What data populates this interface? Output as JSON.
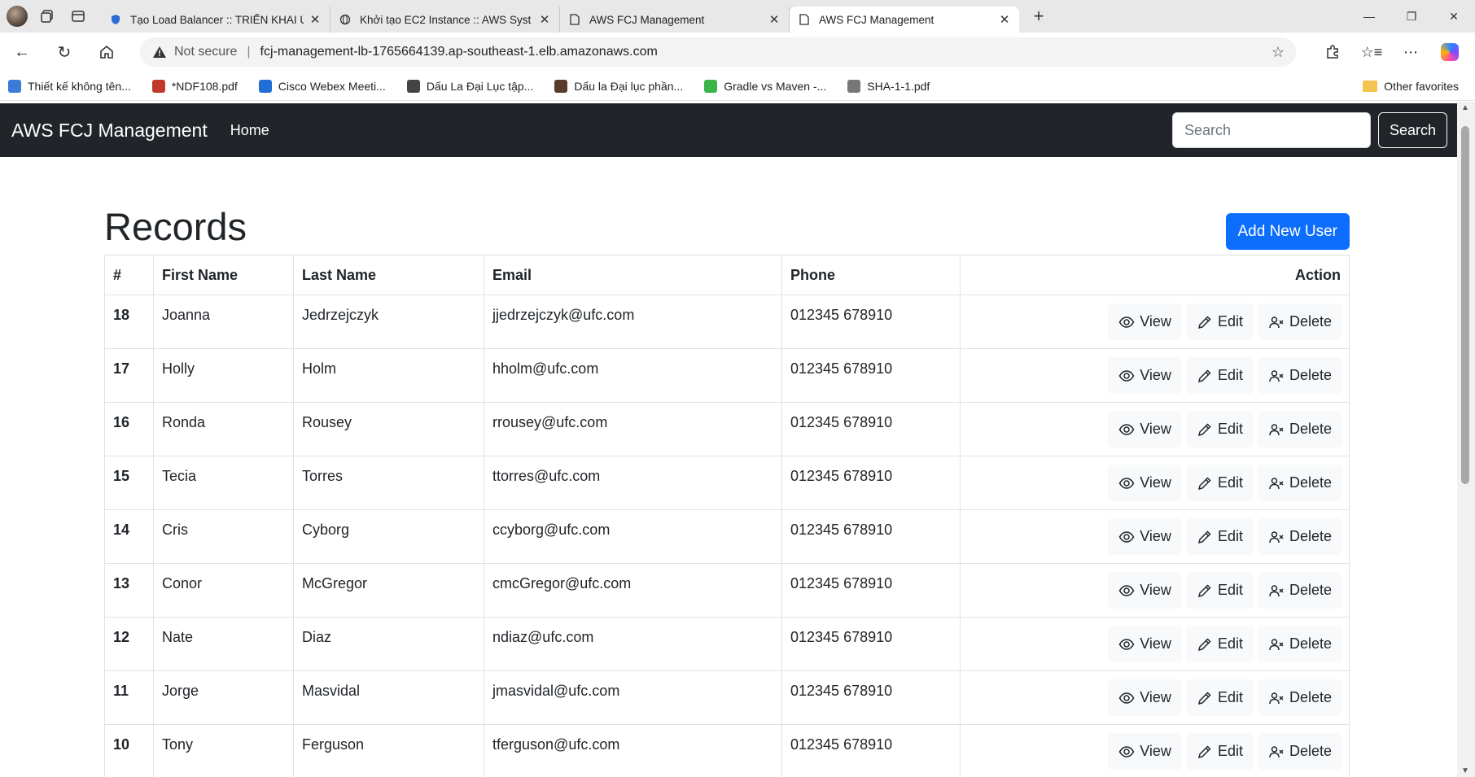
{
  "browser": {
    "tabs": [
      {
        "title": "Tạo Load Balancer :: TRIỂN KHAI Ứ",
        "icon": "shield-icon",
        "active": false
      },
      {
        "title": "Khởi tạo EC2 Instance :: AWS Syst",
        "icon": "globe-icon",
        "active": false
      },
      {
        "title": "AWS FCJ Management",
        "icon": "page-icon",
        "active": false
      },
      {
        "title": "AWS FCJ Management",
        "icon": "page-icon",
        "active": true
      }
    ],
    "address": {
      "security_label": "Not secure",
      "url": "fcj-management-lb-1765664139.ap-southeast-1.elb.amazonaws.com"
    },
    "favorites": [
      {
        "label": "Thiết kế không tên...",
        "color": "#3a7bd5"
      },
      {
        "label": "*NDF108.pdf",
        "color": "#c0392b"
      },
      {
        "label": "Cisco Webex Meeti...",
        "color": "#1f6fd6"
      },
      {
        "label": "Dấu La Đại Lục tập...",
        "color": "#444444"
      },
      {
        "label": "Dấu la Đại lục phần...",
        "color": "#5a3a2a"
      },
      {
        "label": "Gradle vs Maven -...",
        "color": "#3bb54a"
      },
      {
        "label": "SHA-1-1.pdf",
        "color": "#777777"
      }
    ],
    "other_favorites": "Other favorites"
  },
  "app": {
    "brand": "AWS FCJ Management",
    "nav_home": "Home",
    "search_placeholder": "Search",
    "search_button": "Search",
    "page_title": "Records",
    "add_button": "Add New User"
  },
  "table": {
    "headers": {
      "num": "#",
      "first": "First Name",
      "last": "Last Name",
      "email": "Email",
      "phone": "Phone",
      "action": "Action"
    },
    "actions": {
      "view": "View",
      "edit": "Edit",
      "delete": "Delete"
    },
    "rows": [
      {
        "id": "18",
        "first": "Joanna",
        "last": "Jedrzejczyk",
        "email": "jjedrzejczyk@ufc.com",
        "phone": "012345 678910"
      },
      {
        "id": "17",
        "first": "Holly",
        "last": "Holm",
        "email": "hholm@ufc.com",
        "phone": "012345 678910"
      },
      {
        "id": "16",
        "first": "Ronda",
        "last": "Rousey",
        "email": "rrousey@ufc.com",
        "phone": "012345 678910"
      },
      {
        "id": "15",
        "first": "Tecia",
        "last": "Torres",
        "email": "ttorres@ufc.com",
        "phone": "012345 678910"
      },
      {
        "id": "14",
        "first": "Cris",
        "last": "Cyborg",
        "email": "ccyborg@ufc.com",
        "phone": "012345 678910"
      },
      {
        "id": "13",
        "first": "Conor",
        "last": "McGregor",
        "email": "cmcGregor@ufc.com",
        "phone": "012345 678910"
      },
      {
        "id": "12",
        "first": "Nate",
        "last": "Diaz",
        "email": "ndiaz@ufc.com",
        "phone": "012345 678910"
      },
      {
        "id": "11",
        "first": "Jorge",
        "last": "Masvidal",
        "email": "jmasvidal@ufc.com",
        "phone": "012345 678910"
      },
      {
        "id": "10",
        "first": "Tony",
        "last": "Ferguson",
        "email": "tferguson@ufc.com",
        "phone": "012345 678910"
      }
    ]
  },
  "colors": {
    "navbar": "#212529",
    "primary": "#0d6efd",
    "action_bg": "#f8f9fa"
  }
}
